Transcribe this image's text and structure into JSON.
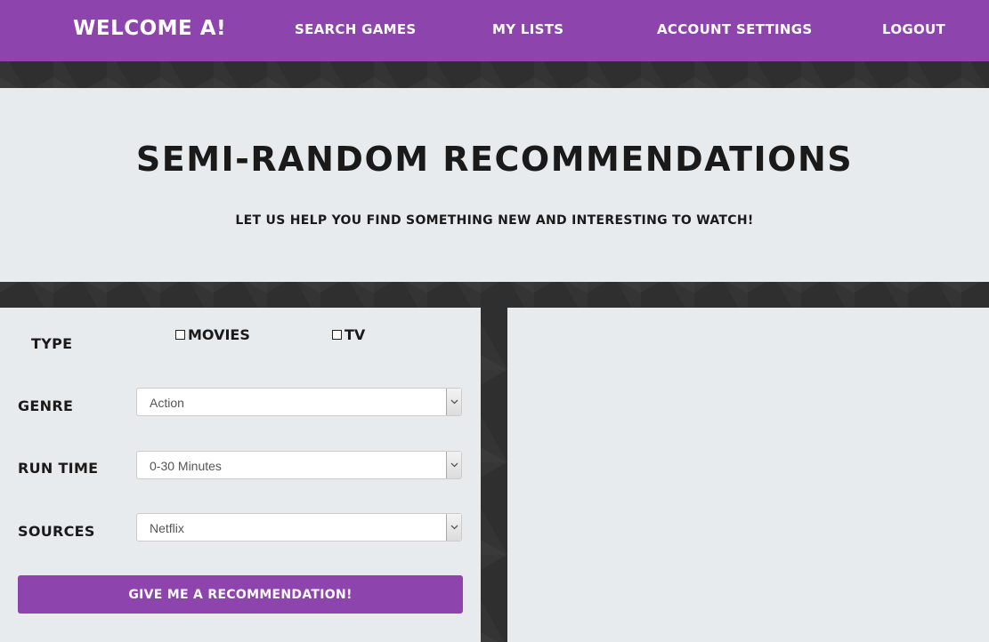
{
  "nav": {
    "brand": "Welcome A!",
    "links": [
      "Search Games",
      "My Lists",
      "Account Settings",
      "Logout"
    ]
  },
  "hero": {
    "title": "Semi-Random Recommendations",
    "subtitle": "Let us help you find something new and interesting to watch!"
  },
  "form": {
    "type_label": "Type",
    "type_options": [
      "Movies",
      "TV"
    ],
    "genre_label": "Genre",
    "genre_value": "Action",
    "runtime_label": "Run Time",
    "runtime_value": "0-30 Minutes",
    "sources_label": "Sources",
    "sources_value": "Netflix",
    "submit_label": "Give me a recommendation!"
  },
  "colors": {
    "accent": "#8e44ad",
    "panel": "#e8ebed",
    "background": "#2f2f2f"
  }
}
